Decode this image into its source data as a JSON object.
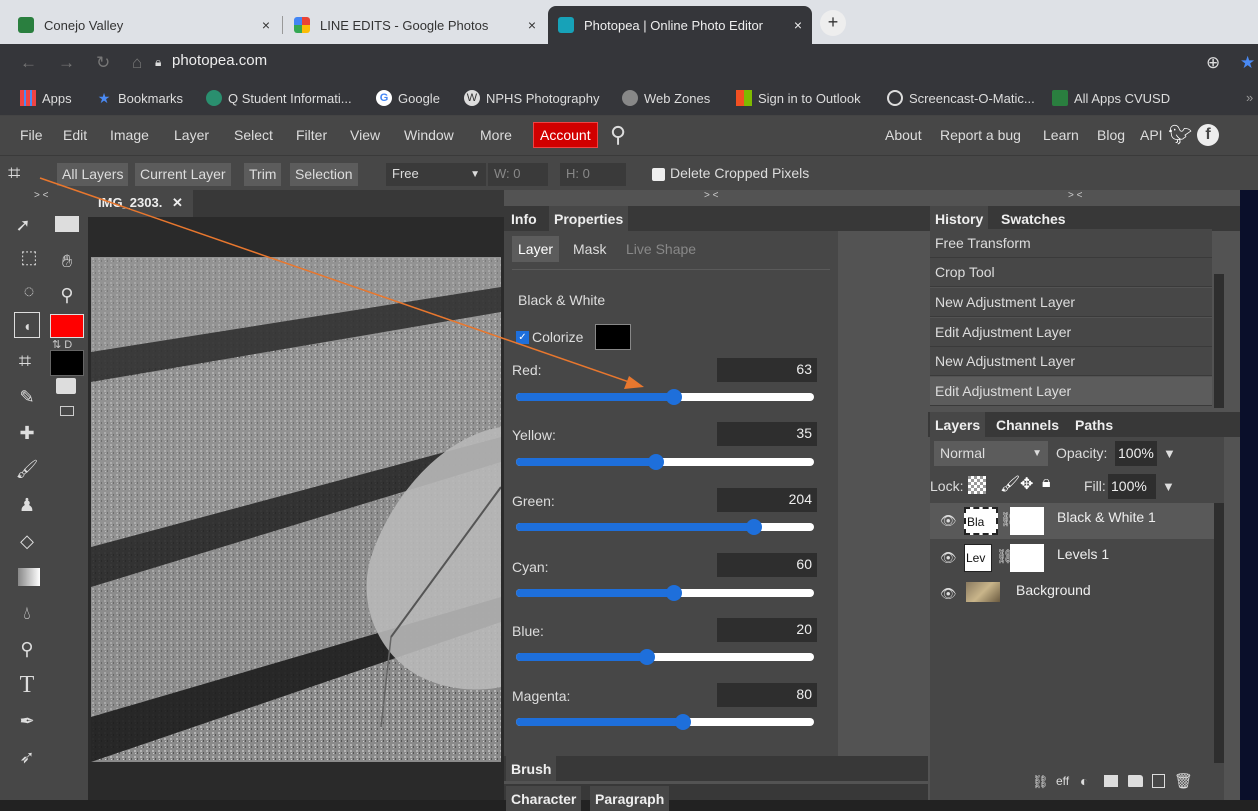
{
  "browser": {
    "tabs": [
      {
        "title": "Conejo Valley",
        "close": "×"
      },
      {
        "title": "LINE EDITS - Google Photos",
        "close": "×"
      },
      {
        "title": "Photopea | Online Photo Editor",
        "close": "×"
      }
    ],
    "new_tab": "+",
    "url": "photopea.com",
    "bookmarks": [
      "Apps",
      "Bookmarks",
      "Q Student Informati...",
      "Google",
      "NPHS Photography",
      "Web Zones",
      "Sign in to Outlook",
      "Screencast-O-Matic...",
      "All Apps CVUSD"
    ],
    "more": "»"
  },
  "menu": {
    "items": [
      "File",
      "Edit",
      "Image",
      "Layer",
      "Select",
      "Filter",
      "View",
      "Window",
      "More"
    ],
    "account": "Account",
    "right": [
      "About",
      "Report a bug",
      "Learn",
      "Blog",
      "API"
    ]
  },
  "options": {
    "buttons": [
      "All Layers",
      "Current Layer",
      "Trim",
      "Selection"
    ],
    "ratio": "Free",
    "w": "W: 0",
    "h": "H: 0",
    "delete_cropped": "Delete Cropped Pixels"
  },
  "document": {
    "tab": "IMG_2303.",
    "close": "✕"
  },
  "collapse": ">  <",
  "properties": {
    "tabs": [
      "Info",
      "Properties"
    ],
    "subtabs": [
      "Layer",
      "Mask",
      "Live Shape"
    ],
    "adjustment": "Black & White",
    "colorize": "Colorize",
    "sliders": [
      {
        "label": "Red:",
        "value": 63,
        "fill": 0.53
      },
      {
        "label": "Yellow:",
        "value": 35,
        "fill": 0.47
      },
      {
        "label": "Green:",
        "value": 204,
        "fill": 0.8
      },
      {
        "label": "Cyan:",
        "value": 60,
        "fill": 0.53
      },
      {
        "label": "Blue:",
        "value": 20,
        "fill": 0.44
      },
      {
        "label": "Magenta:",
        "value": 80,
        "fill": 0.56
      }
    ],
    "bottom_tabs": [
      "Brush",
      "Character",
      "Paragraph"
    ]
  },
  "history": {
    "tabs": [
      "History",
      "Swatches"
    ],
    "items": [
      "Free Transform",
      "Crop Tool",
      "New Adjustment Layer",
      "Edit Adjustment Layer",
      "New Adjustment Layer",
      "Edit Adjustment Layer"
    ]
  },
  "layers": {
    "tabs": [
      "Layers",
      "Channels",
      "Paths"
    ],
    "blend": "Normal",
    "opacity_label": "Opacity:",
    "opacity": "100%",
    "lock": "Lock:",
    "fill_label": "Fill:",
    "fill": "100%",
    "items": [
      {
        "thumb": "Bla",
        "name": "Black & White 1"
      },
      {
        "thumb": "Lev",
        "name": "Levels 1"
      },
      {
        "thumb": "",
        "name": "Background"
      }
    ],
    "footer": [
      "eff"
    ]
  },
  "colors": {
    "primary": "#ff0000",
    "secondary": "#000000",
    "account": "#d10000",
    "slider": "#1e6fdb",
    "annotation": "#e8772e"
  }
}
